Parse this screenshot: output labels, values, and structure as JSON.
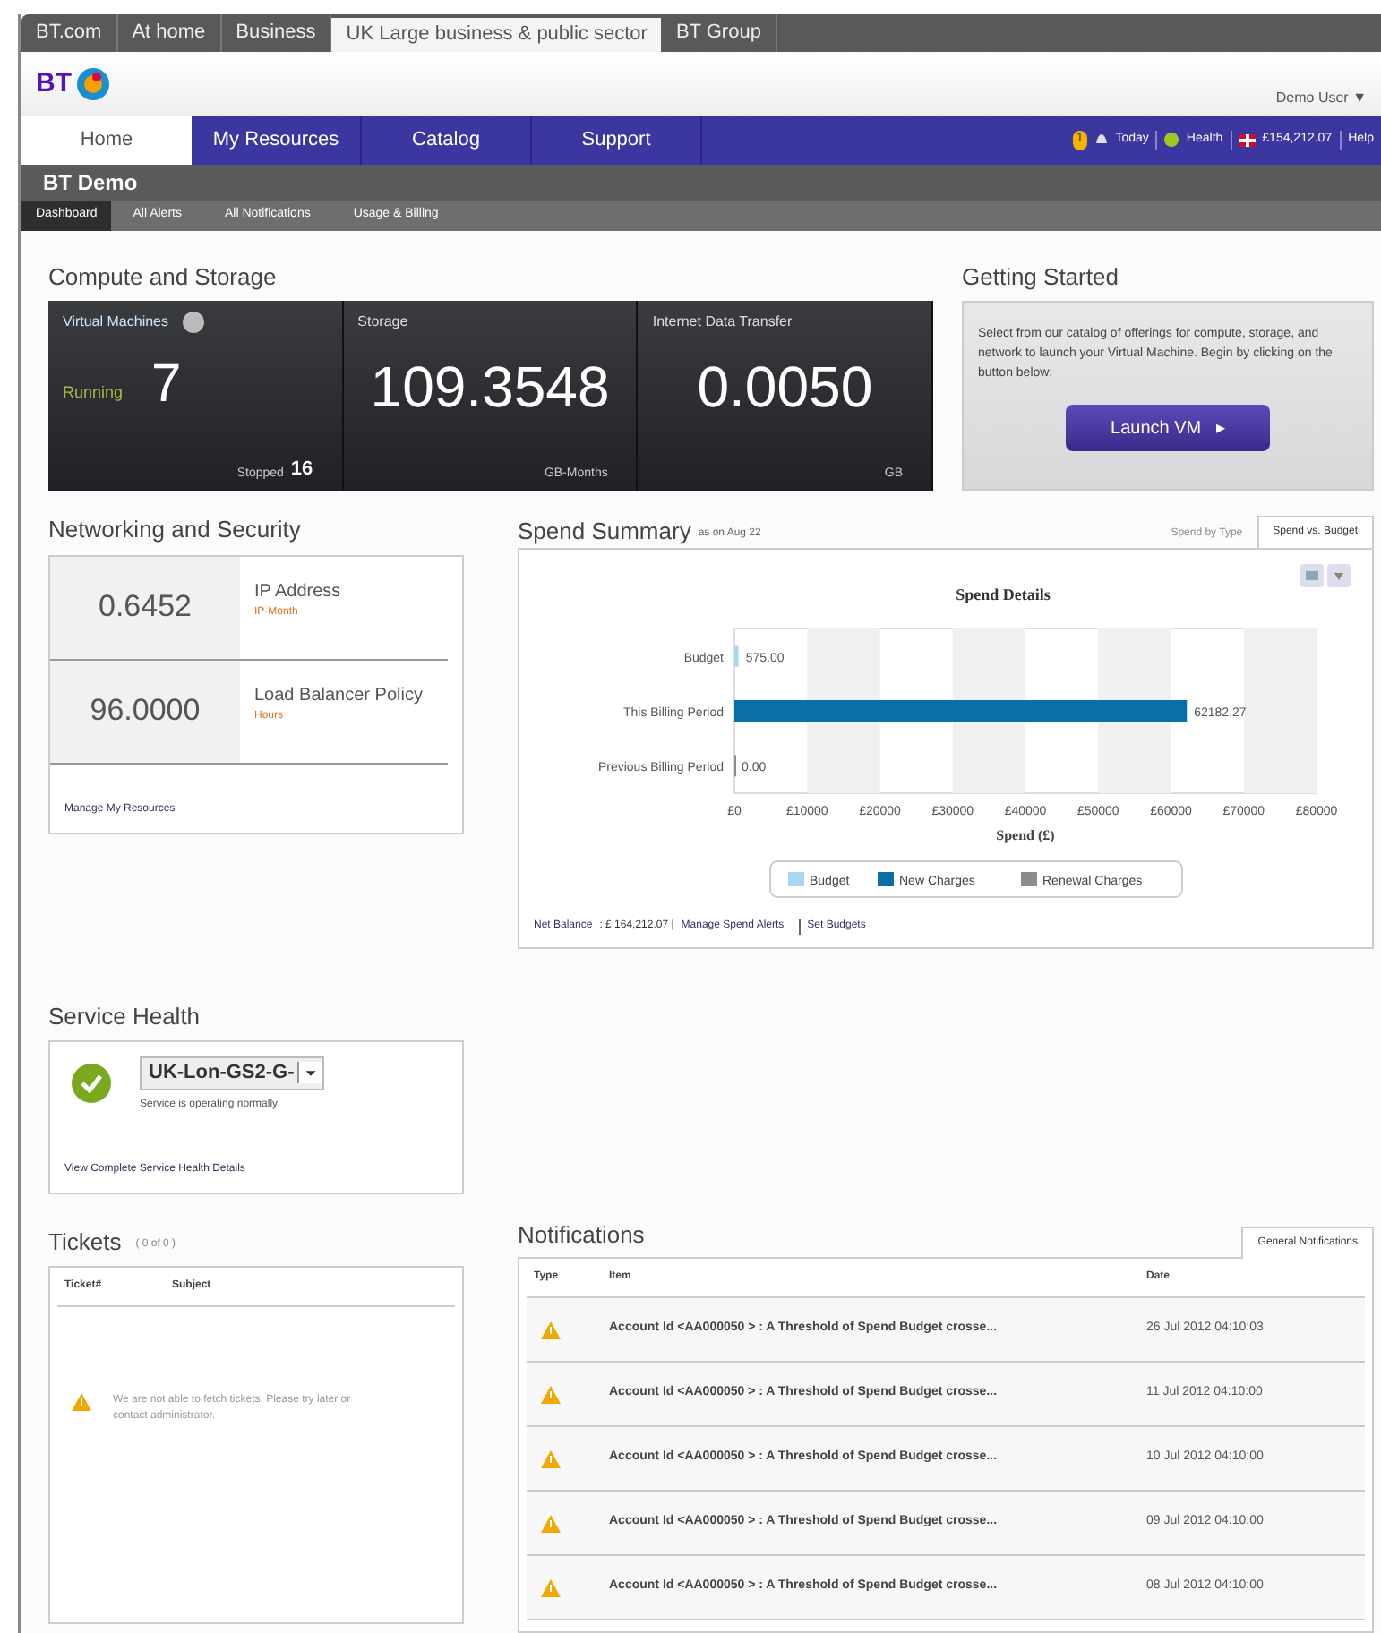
{
  "site_tabs": [
    {
      "label": "BT.com",
      "selected": false
    },
    {
      "label": "At home",
      "selected": false
    },
    {
      "label": "Business",
      "selected": false
    },
    {
      "label": "UK Large business & public sector",
      "selected": true
    },
    {
      "label": "BT Group",
      "selected": false
    }
  ],
  "logo": {
    "text": "BT"
  },
  "user_menu": {
    "label": "Demo User",
    "caret": "▼"
  },
  "nav": [
    {
      "label": "Home",
      "selected": true
    },
    {
      "label": "My Resources",
      "selected": false
    },
    {
      "label": "Catalog",
      "selected": false
    },
    {
      "label": "Support",
      "selected": false
    }
  ],
  "nav_status": {
    "alert_count": "1",
    "today": "Today",
    "health": "Health",
    "balance": "£154,212.07",
    "help": "Help"
  },
  "page_title": "BT Demo",
  "sub_tabs": [
    {
      "label": "Dashboard",
      "selected": true
    },
    {
      "label": "All Alerts",
      "selected": false
    },
    {
      "label": "All Notifications",
      "selected": false
    },
    {
      "label": "Usage & Billing",
      "selected": false
    }
  ],
  "compute": {
    "title": "Compute and Storage",
    "tiles": [
      {
        "kind": "vm",
        "label": "Virtual Machines",
        "state_label": "Running",
        "value": "7",
        "footer_label": "Stopped",
        "footer_value": "16"
      },
      {
        "kind": "metric",
        "label": "Storage",
        "value": "109.3548",
        "footer_label": "GB-Months"
      },
      {
        "kind": "metric",
        "label": "Internet Data Transfer",
        "value": "0.0050",
        "footer_label": "GB"
      }
    ]
  },
  "getting_started": {
    "title": "Getting Started",
    "text": "Select from our catalog of offerings for compute, storage, and network to launch your Virtual Machine. Begin by clicking on the button below:",
    "button": "Launch VM",
    "button_arrow": "▸"
  },
  "networking": {
    "title": "Networking and Security",
    "rows": [
      {
        "value": "0.6452",
        "label": "IP Address",
        "unit": "IP-Month"
      },
      {
        "value": "96.0000",
        "label": "Load Balancer Policy",
        "unit": "Hours"
      }
    ],
    "link": "Manage My Resources"
  },
  "spend": {
    "title": "Spend Summary",
    "as_of": "as on Aug 22",
    "tabs": [
      {
        "label": "Spend by Type",
        "selected": false
      },
      {
        "label": "Spend vs. Budget",
        "selected": true
      }
    ],
    "chart_data": {
      "type": "bar",
      "orientation": "horizontal",
      "title": "Spend Details",
      "xlabel": "Spend (£)",
      "categories": [
        "Budget",
        "This Billing Period",
        "Previous Billing Period"
      ],
      "series": [
        {
          "name": "Budget",
          "color": "#a8d8f0",
          "values": [
            575,
            null,
            null
          ]
        },
        {
          "name": "New Charges",
          "color": "#0a6fa8",
          "values": [
            null,
            62182.27,
            null
          ]
        },
        {
          "name": "Renewal Charges",
          "color": "#8c8c8c",
          "values": [
            null,
            null,
            0
          ]
        }
      ],
      "xlim": [
        0,
        80000
      ],
      "legend": true,
      "xticks": [
        {
          "value": 0,
          "label": "£0"
        },
        {
          "value": 10000,
          "label": "£10000"
        },
        {
          "value": 20000,
          "label": "£20000"
        },
        {
          "value": 30000,
          "label": "£30000"
        },
        {
          "value": 40000,
          "label": "£40000"
        },
        {
          "value": 50000,
          "label": "£50000"
        },
        {
          "value": 60000,
          "label": "£60000"
        },
        {
          "value": 70000,
          "label": "£70000"
        },
        {
          "value": 80000,
          "label": "£80000"
        }
      ],
      "value_labels": [
        "575.00",
        "62182.27",
        "0.00"
      ]
    },
    "footer": {
      "balance_label": "Net Balance",
      "balance_value": ": £ 164,212.07 |",
      "links": [
        "Manage Spend Alerts",
        "Set Budgets"
      ]
    }
  },
  "service_health": {
    "title": "Service Health",
    "location": "UK-Lon-GS2-G-",
    "status": "Service is operating normally",
    "link": "View Complete Service Health Details"
  },
  "tickets": {
    "title": "Tickets",
    "count": "( 0 of 0 )",
    "columns": [
      "Ticket#",
      "Subject"
    ],
    "message": "We are not able to fetch tickets. Please try later or contact administrator."
  },
  "notifications": {
    "title": "Notifications",
    "tab": "General Notifications",
    "columns": [
      "Type",
      "Item",
      "Date"
    ],
    "rows": [
      {
        "item": "Account Id <AA000050 > : A Threshold of Spend Budget crosse...",
        "date": "26 Jul 2012 04:10:03"
      },
      {
        "item": "Account Id <AA000050 > : A Threshold of Spend Budget crosse...",
        "date": "11 Jul 2012 04:10:00"
      },
      {
        "item": "Account Id <AA000050 > : A Threshold of Spend Budget crosse...",
        "date": "10 Jul 2012 04:10:00"
      },
      {
        "item": "Account Id <AA000050 > : A Threshold of Spend Budget crosse...",
        "date": "09 Jul 2012 04:10:00"
      },
      {
        "item": "Account Id <AA000050 > : A Threshold of Spend Budget crosse...",
        "date": "08 Jul 2012 04:10:00"
      }
    ]
  }
}
